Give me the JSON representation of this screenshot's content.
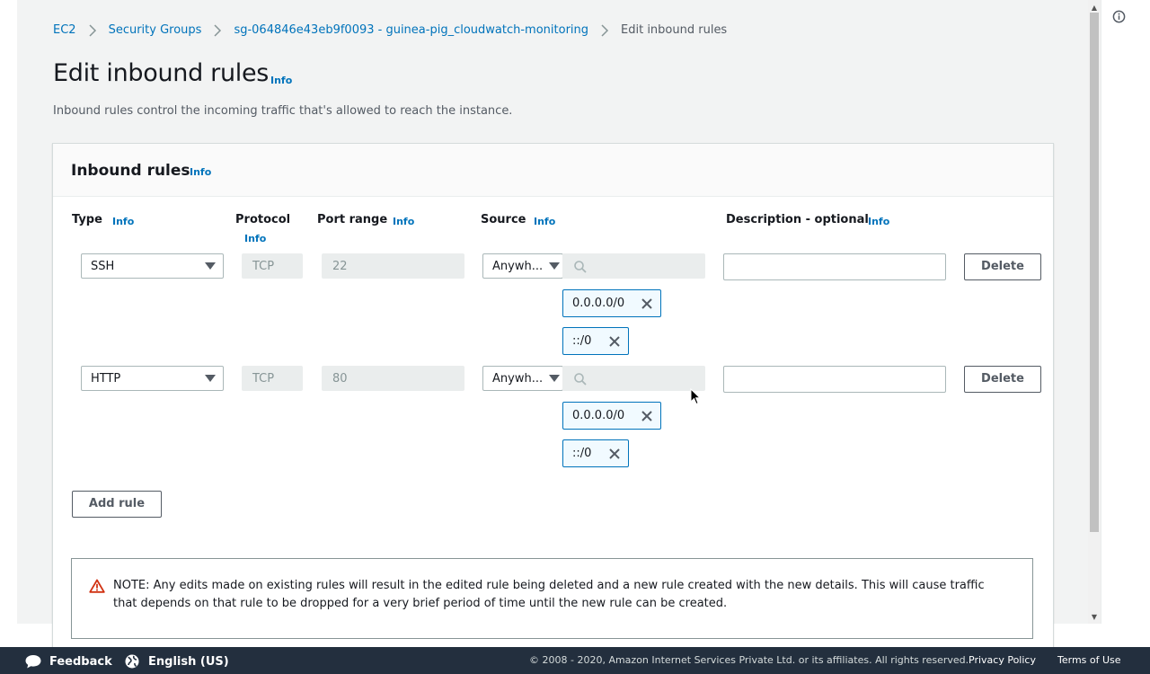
{
  "breadcrumb": {
    "items": [
      "EC2",
      "Security Groups",
      "sg-064846e43eb9f0093 - guinea-pig_cloudwatch-monitoring"
    ],
    "current": "Edit inbound rules"
  },
  "page": {
    "title": "Edit inbound rules",
    "title_info": "Info",
    "description": "Inbound rules control the incoming traffic that's allowed to reach the instance."
  },
  "panel": {
    "title": "Inbound rules",
    "info": "Info",
    "columns": {
      "type": "Type",
      "protocol": "Protocol",
      "port_range": "Port range",
      "source": "Source",
      "description": "Description - optional",
      "info": "Info"
    }
  },
  "rules": [
    {
      "type": "SSH",
      "protocol": "TCP",
      "port_range": "22",
      "source": "Anywh...",
      "cidrs": [
        "0.0.0.0/0",
        "::/0"
      ],
      "delete_label": "Delete"
    },
    {
      "type": "HTTP",
      "protocol": "TCP",
      "port_range": "80",
      "source": "Anywh...",
      "cidrs": [
        "0.0.0.0/0",
        "::/0"
      ],
      "delete_label": "Delete"
    }
  ],
  "add_rule_label": "Add rule",
  "note": "NOTE: Any edits made on existing rules will result in the edited rule being deleted and a new rule created with the new details. This will cause traffic that depends on that rule to be dropped for a very brief period of time until the new rule can be created.",
  "footer": {
    "feedback": "Feedback",
    "language": "English (US)",
    "copyright": "© 2008 - 2020, Amazon Internet Services Private Ltd. or its affiliates. All rights reserved.",
    "privacy": "Privacy Policy",
    "terms": "Terms of Use"
  },
  "colors": {
    "link": "#0073bb",
    "footer_bg": "#232f3e",
    "token_border": "#0073bb",
    "warning": "#d13212"
  }
}
